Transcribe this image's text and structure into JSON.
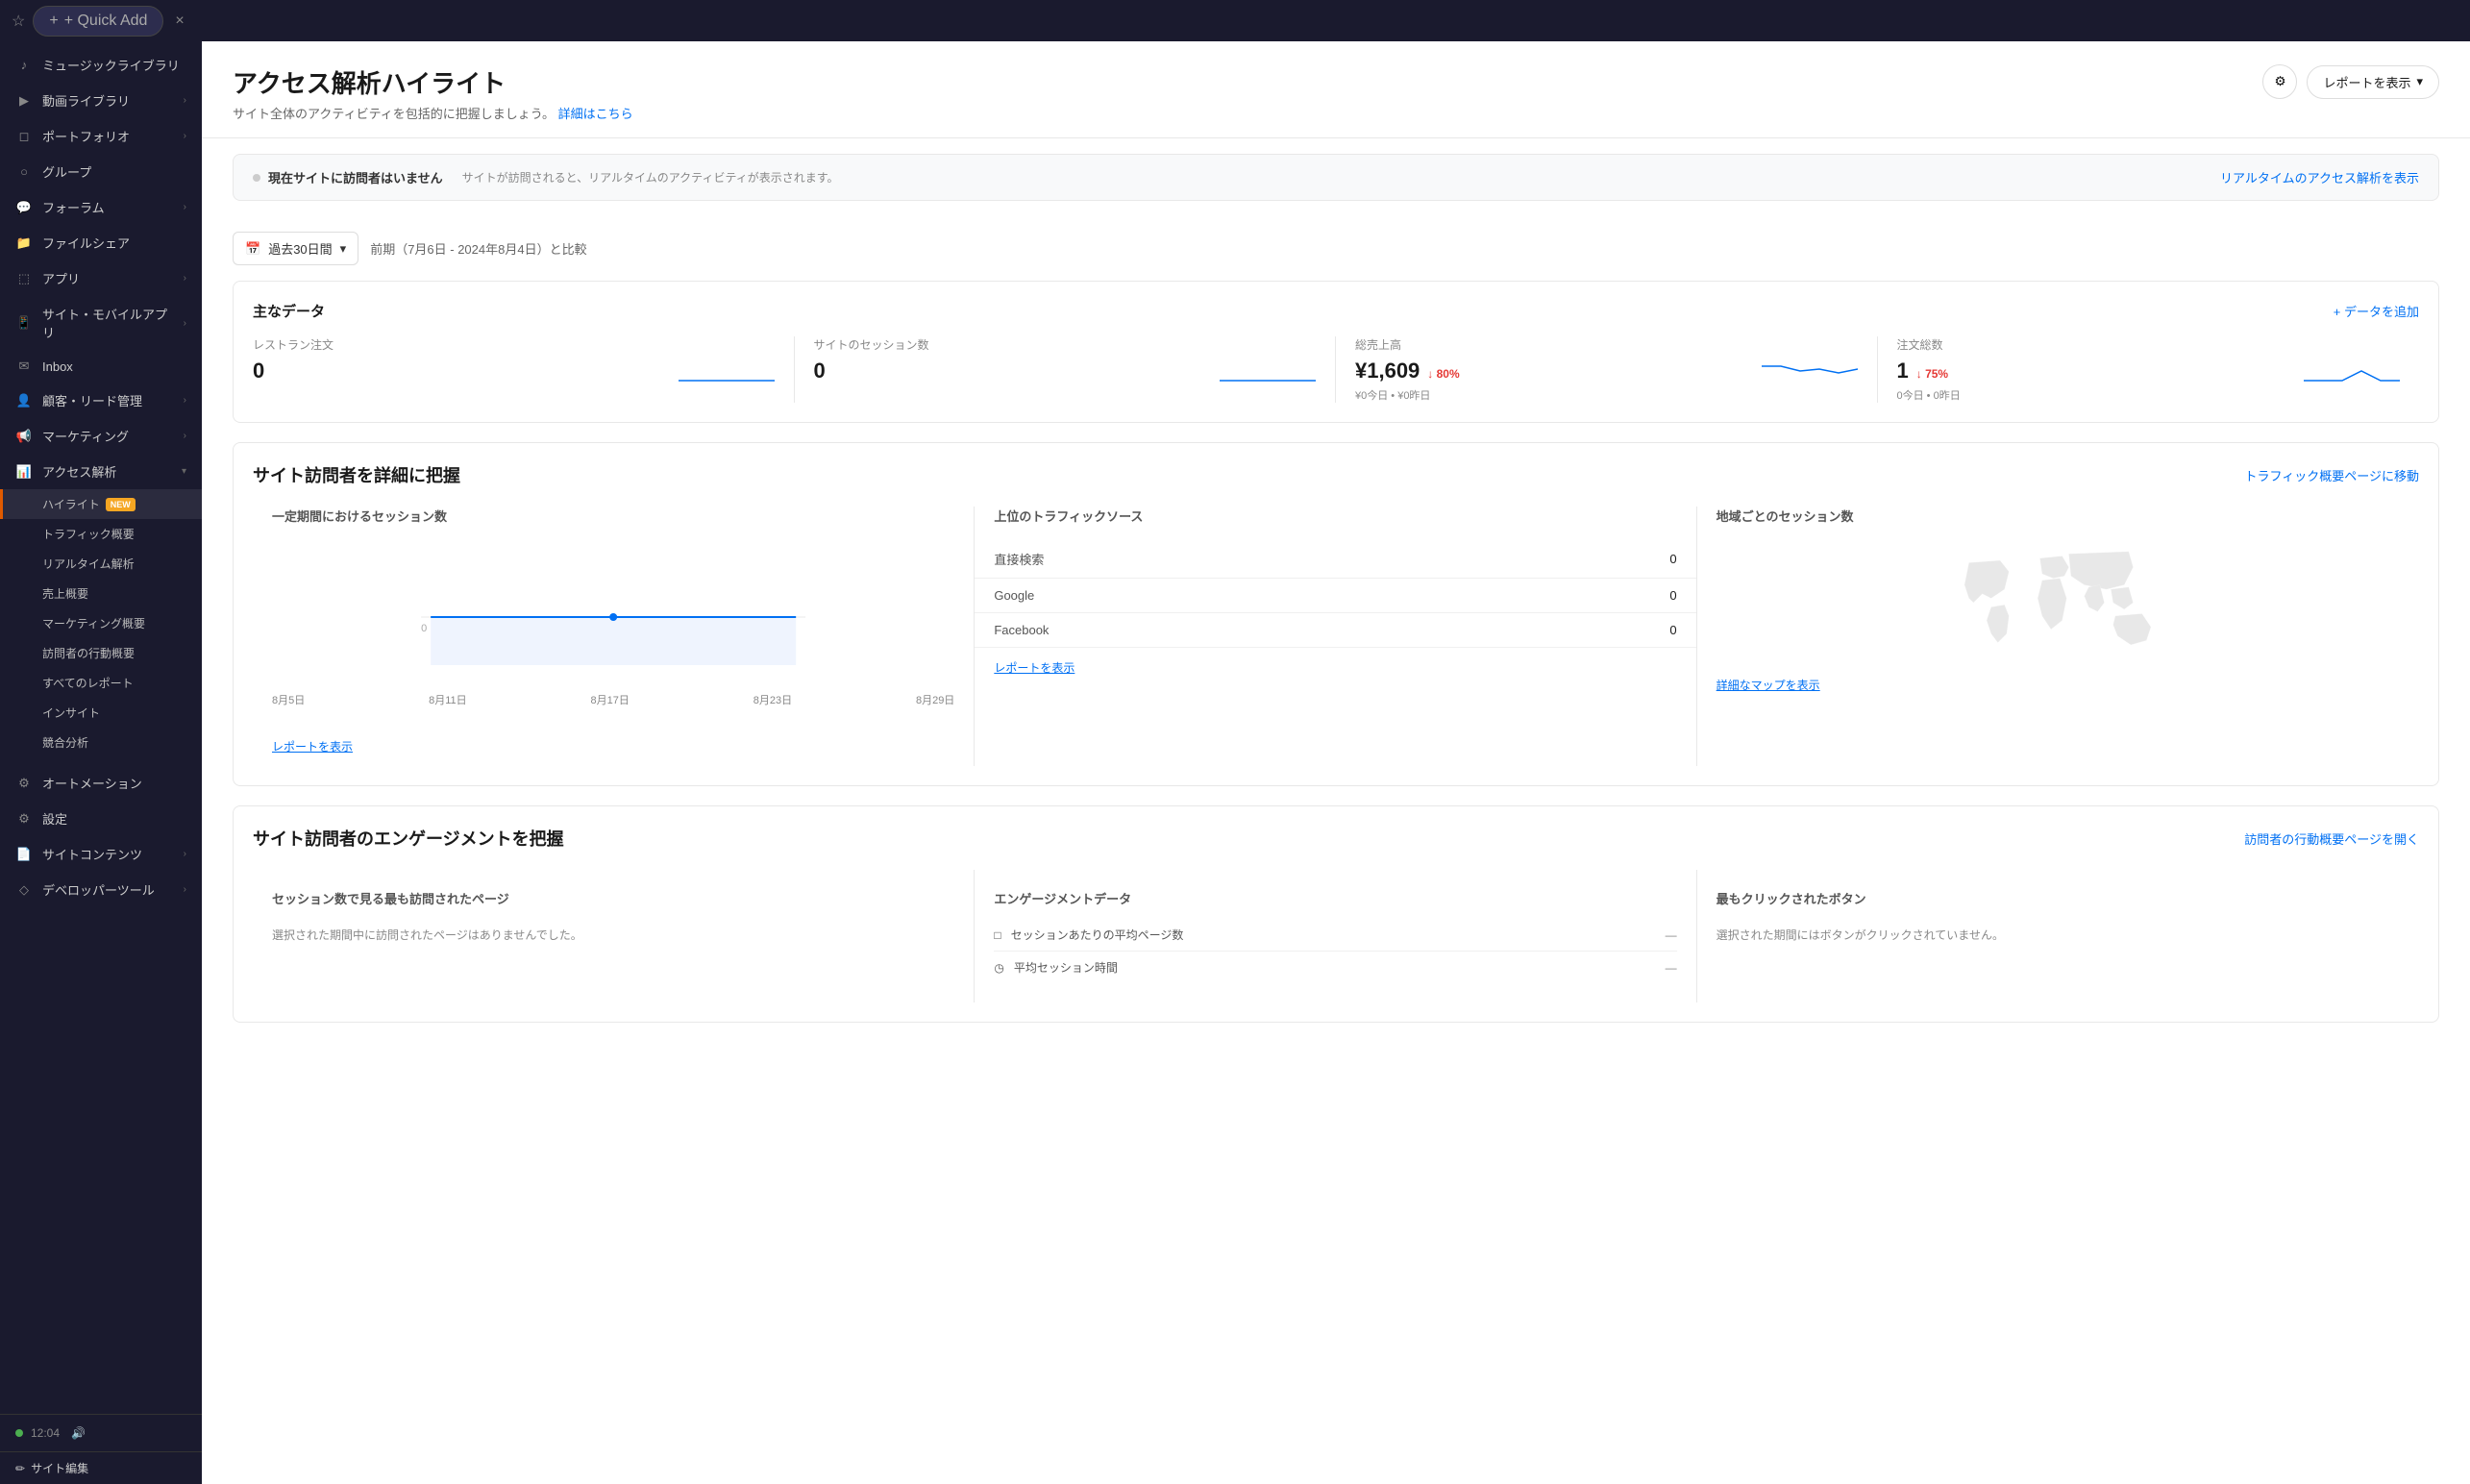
{
  "topbar": {
    "quick_add": "+ Quick Add",
    "close": "×"
  },
  "sidebar": {
    "items": [
      {
        "id": "music-library",
        "icon": "♪",
        "label": "ミュージックライブラリ",
        "chevron": false
      },
      {
        "id": "video-library",
        "icon": "▶",
        "label": "動画ライブラリ",
        "chevron": true
      },
      {
        "id": "portfolio",
        "icon": "◻",
        "label": "ポートフォリオ",
        "chevron": true
      },
      {
        "id": "groups",
        "icon": "◯",
        "label": "グループ",
        "chevron": false
      },
      {
        "id": "forum",
        "icon": "💬",
        "label": "フォーラム",
        "chevron": true
      },
      {
        "id": "file-share",
        "icon": "📁",
        "label": "ファイルシェア",
        "chevron": false
      },
      {
        "id": "apps",
        "icon": "⬚",
        "label": "アプリ",
        "chevron": true
      },
      {
        "id": "site-mobile",
        "icon": "📱",
        "label": "サイト・モバイルアプリ",
        "chevron": true
      },
      {
        "id": "inbox",
        "icon": "✉",
        "label": "Inbox",
        "chevron": false
      },
      {
        "id": "crm",
        "icon": "👤",
        "label": "顧客・リード管理",
        "chevron": true
      },
      {
        "id": "marketing",
        "icon": "📢",
        "label": "マーケティング",
        "chevron": true
      },
      {
        "id": "analytics",
        "icon": "📊",
        "label": "アクセス解析",
        "chevron": true
      }
    ],
    "analytics_sub": [
      {
        "id": "highlight",
        "label": "ハイライト",
        "badge": "NEW",
        "active": true
      },
      {
        "id": "traffic-overview",
        "label": "トラフィック概要",
        "active": false
      },
      {
        "id": "realtime",
        "label": "リアルタイム解析",
        "active": false
      },
      {
        "id": "sales-overview",
        "label": "売上概要",
        "active": false
      },
      {
        "id": "marketing-overview",
        "label": "マーケティング概要",
        "active": false
      },
      {
        "id": "visitor-behavior",
        "label": "訪問者の行動概要",
        "active": false
      },
      {
        "id": "all-reports",
        "label": "すべてのレポート",
        "active": false
      },
      {
        "id": "insights",
        "label": "インサイト",
        "active": false
      },
      {
        "id": "competitive",
        "label": "競合分析",
        "active": false
      }
    ],
    "bottom_items": [
      {
        "id": "automation",
        "icon": "⚙",
        "label": "オートメーション",
        "chevron": false
      },
      {
        "id": "settings",
        "icon": "⚙",
        "label": "設定",
        "chevron": false
      },
      {
        "id": "site-content",
        "icon": "📄",
        "label": "サイトコンテンツ",
        "chevron": true
      },
      {
        "id": "developer-tools",
        "icon": "◇",
        "label": "デベロッパーツール",
        "chevron": true
      }
    ],
    "time": "12:04",
    "edit_site": "サイト編集"
  },
  "page": {
    "title": "アクセス解析ハイライト",
    "subtitle": "サイト全体のアクティビティを包括的に把握しましょう。",
    "subtitle_link": "詳細はこちら",
    "settings_icon": "⚙",
    "report_button": "レポートを表示",
    "report_chevron": "▾"
  },
  "visitor_banner": {
    "status": "現在サイトに訪問者はいません",
    "description": "サイトが訪問されると、リアルタイムのアクティビティが表示されます。",
    "link": "リアルタイムのアクセス解析を表示"
  },
  "date_filter": {
    "period": "過去30日間",
    "comparison": "前期（7月6日 - 2024年8月4日）と比較",
    "calendar_icon": "📅"
  },
  "main_data": {
    "title": "主なデータ",
    "add_link": "+ データを追加",
    "metrics": [
      {
        "id": "restaurant-orders",
        "label": "レストラン注文",
        "value": "0",
        "change": "",
        "sub": "",
        "has_chart": true
      },
      {
        "id": "site-sessions",
        "label": "サイトのセッション数",
        "value": "0",
        "change": "",
        "sub": "",
        "has_chart": true
      },
      {
        "id": "total-sales",
        "label": "総売上高",
        "value": "¥1,609",
        "change": "↓ 80%",
        "change_type": "down",
        "sub": "¥0今日 • ¥0昨日",
        "has_chart": true
      },
      {
        "id": "total-orders",
        "label": "注文総数",
        "value": "1",
        "change": "↓ 75%",
        "change_type": "down",
        "sub": "0今日 • 0昨日",
        "has_chart": true
      }
    ]
  },
  "visitor_section": {
    "title": "サイト訪問者を詳細に把握",
    "link": "トラフィック概要ページに移動",
    "chart": {
      "title": "一定期間におけるセッション数",
      "zero_label": "0",
      "x_labels": [
        "8月5日",
        "8月11日",
        "8月17日",
        "8月23日",
        "8月29日"
      ],
      "report_link": "レポートを表示"
    },
    "traffic_sources": {
      "title": "上位のトラフィックソース",
      "sources": [
        {
          "name": "直接検索",
          "value": "0"
        },
        {
          "name": "Google",
          "value": "0"
        },
        {
          "name": "Facebook",
          "value": "0"
        }
      ],
      "report_link": "レポートを表示"
    },
    "map": {
      "title": "地域ごとのセッション数",
      "map_link": "詳細なマップを表示"
    }
  },
  "engagement_section": {
    "title": "サイト訪問者のエンゲージメントを把握",
    "link": "訪問者の行動概要ページを開く",
    "most_visited": {
      "title": "セッション数で見る最も訪問されたページ",
      "empty": "選択された期間中に訪問されたページはありませんでした。"
    },
    "engagement_data": {
      "title": "エンゲージメントデータ",
      "rows": [
        {
          "icon": "□",
          "label": "セッションあたりの平均ページ数",
          "value": "—"
        },
        {
          "icon": "◷",
          "label": "平均セッション時間",
          "value": "—"
        }
      ]
    },
    "most_clicked": {
      "title": "最もクリックされたボタン",
      "empty": "選択された期間にはボタンがクリックされていません。"
    }
  }
}
